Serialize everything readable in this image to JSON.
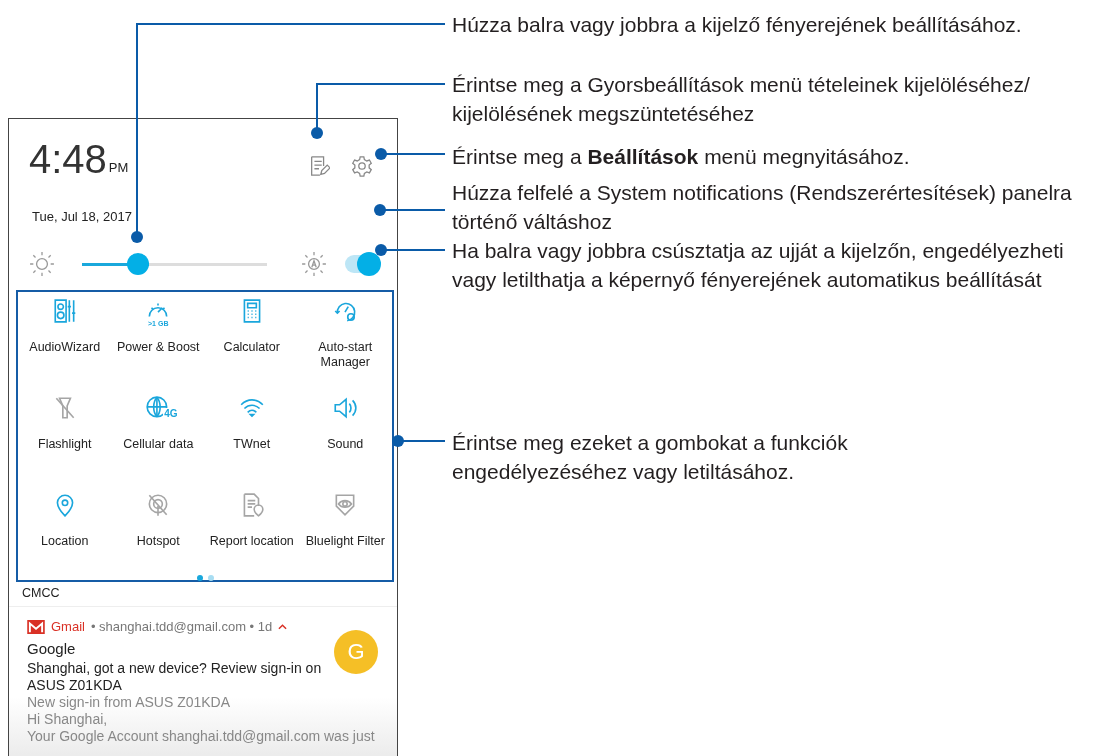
{
  "phone": {
    "time": "4:48",
    "meridiem": "PM",
    "date": "Tue, Jul 18, 2017",
    "brightness": {
      "level": 0.34
    },
    "auto_brightness": {
      "on": true
    },
    "tiles": [
      {
        "label": "AudioWizard",
        "on": true
      },
      {
        "label": "Power & Boost",
        "on": true,
        "badge": ">1 GB"
      },
      {
        "label": "Calculator",
        "on": true
      },
      {
        "label": "Auto-start Manager",
        "on": true
      },
      {
        "label": "Flashlight",
        "on": false
      },
      {
        "label": "Cellular data",
        "on": true,
        "badge": "4G"
      },
      {
        "label": "TWnet",
        "on": true
      },
      {
        "label": "Sound",
        "on": true
      },
      {
        "label": "Location",
        "on": true
      },
      {
        "label": "Hotspot",
        "on": false
      },
      {
        "label": "Report location",
        "on": false
      },
      {
        "label": "Bluelight Filter",
        "on": false
      }
    ],
    "pages": [
      {
        "selected": true
      },
      {
        "selected": false
      }
    ],
    "carrier": "CMCC",
    "notification": {
      "app": "Gmail",
      "account": "• shanghai.tdd@gmail.com • 1d",
      "avatar": "G",
      "sender": "Google",
      "subject": "Shanghai, got a new device? Review sign-in on ASUS Z01KDA",
      "lines": [
        "New sign-in from ASUS Z01KDA",
        "Hi Shanghai,",
        "Your Google Account shanghai.tdd@gmail.com was just"
      ]
    }
  },
  "callouts": [
    {
      "lines": [
        "Húzza balra vagy jobbra a kijelző fényerejének beállításához."
      ]
    },
    {
      "lines": [
        "Érintse meg a Gyorsbeállítások menü tételeinek kijelöléséhez/",
        "kijelölésének megszüntetéséhez"
      ]
    },
    {
      "lines": [
        "Érintse meg a **Beállítások** menü megnyitásához."
      ]
    },
    {
      "lines": [
        "Húzza felfelé a System notifications (Rendszerértesítések) panelra",
        "történő váltáshoz"
      ]
    },
    {
      "lines": [
        "Ha balra vagy jobbra csúsztatja az ujját a kijelzőn, engedélyezheti",
        "vagy letilthatja a képernyő fényerejének automatikus beállítását"
      ]
    },
    {
      "lines": [
        "Érintse meg ezeket a gombokat a funkciók",
        "engedélyezéséhez vagy letiltásához."
      ]
    }
  ]
}
